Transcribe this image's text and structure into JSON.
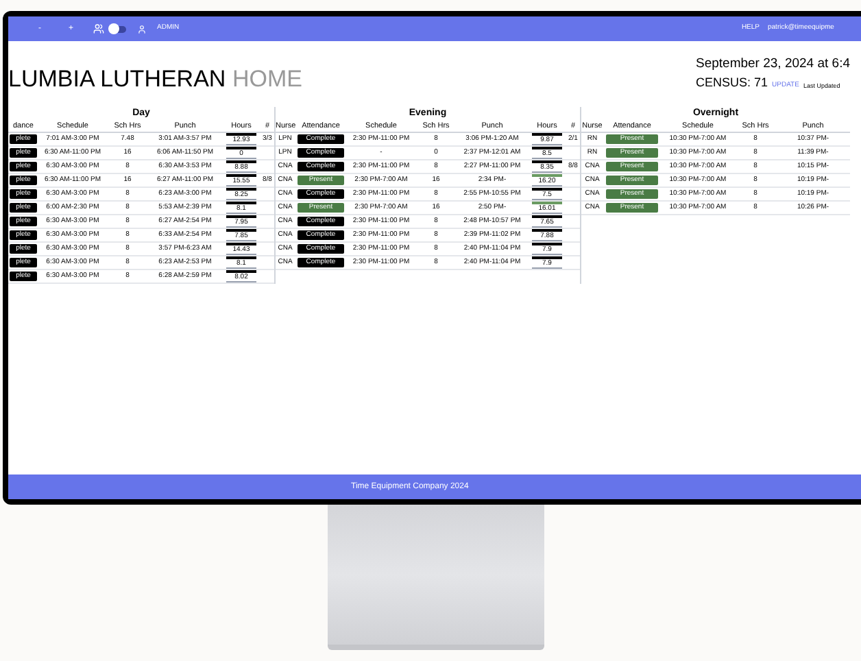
{
  "nav": {
    "minus": "-",
    "plus": "+",
    "toggle": {
      "on": false
    },
    "admin": "ADMIN",
    "help": "HELP",
    "user": "patrick@timeequipme"
  },
  "header": {
    "title": "LUMBIA LUTHERAN",
    "title_light": "HOME",
    "date": "September 23, 2024 at 6:4",
    "census": "CENSUS: 71",
    "update": "UPDATE",
    "last_updated": "Last Updated"
  },
  "day": {
    "title": "Day",
    "columns": [
      "dance",
      "Schedule",
      "Sch Hrs",
      "Punch",
      "Hours",
      "#"
    ],
    "rows": [
      {
        "attendance": {
          "label": "plete",
          "kind": "complete"
        },
        "schedule": "7:01 AM-3:00 PM",
        "sch_hrs": "7.48",
        "punch": "3:01 AM-3:57 PM",
        "hours": "12.93",
        "count": "3/3"
      },
      {
        "attendance": {
          "label": "plete",
          "kind": "complete"
        },
        "schedule": "6:30 AM-11:00 PM",
        "sch_hrs": "16",
        "punch": "6:06 AM-11:50 PM",
        "hours": "0"
      },
      {
        "attendance": {
          "label": "plete",
          "kind": "complete"
        },
        "schedule": "6:30 AM-3:00 PM",
        "sch_hrs": "8",
        "punch": "6:30 AM-3:53 PM",
        "hours": "8.88"
      },
      {
        "attendance": {
          "label": "plete",
          "kind": "complete"
        },
        "schedule": "6:30 AM-11:00 PM",
        "sch_hrs": "16",
        "punch": "6:27 AM-11:00 PM",
        "hours": "15.55",
        "count": "8/8"
      },
      {
        "attendance": {
          "label": "plete",
          "kind": "complete"
        },
        "schedule": "6:30 AM-3:00 PM",
        "sch_hrs": "8",
        "punch": "6:23 AM-3:00 PM",
        "hours": "8.25"
      },
      {
        "attendance": {
          "label": "plete",
          "kind": "complete"
        },
        "schedule": "6:00 AM-2:30 PM",
        "sch_hrs": "8",
        "punch": "5:53 AM-2:39 PM",
        "hours": "8.1"
      },
      {
        "attendance": {
          "label": "plete",
          "kind": "complete"
        },
        "schedule": "6:30 AM-3:00 PM",
        "sch_hrs": "8",
        "punch": "6:27 AM-2:54 PM",
        "hours": "7.95"
      },
      {
        "attendance": {
          "label": "plete",
          "kind": "complete"
        },
        "schedule": "6:30 AM-3:00 PM",
        "sch_hrs": "8",
        "punch": "6:33 AM-2:54 PM",
        "hours": "7.85"
      },
      {
        "attendance": {
          "label": "plete",
          "kind": "complete"
        },
        "schedule": "6:30 AM-3:00 PM",
        "sch_hrs": "8",
        "punch": "3:57 PM-6:23 AM",
        "hours": "14.43"
      },
      {
        "attendance": {
          "label": "plete",
          "kind": "complete"
        },
        "schedule": "6:30 AM-3:00 PM",
        "sch_hrs": "8",
        "punch": "6:23 AM-2:53 PM",
        "hours": "8.1"
      },
      {
        "attendance": {
          "label": "plete",
          "kind": "complete"
        },
        "schedule": "6:30 AM-3:00 PM",
        "sch_hrs": "8",
        "punch": "6:28 AM-2:59 PM",
        "hours": "8.02"
      }
    ]
  },
  "evening": {
    "title": "Evening",
    "columns": [
      "Nurse",
      "Attendance",
      "Schedule",
      "Sch Hrs",
      "Punch",
      "Hours",
      "#"
    ],
    "rows": [
      {
        "nurse": "LPN",
        "attendance": {
          "label": "Complete",
          "kind": "complete"
        },
        "schedule": "2:30 PM-11:00 PM",
        "sch_hrs": "8",
        "punch": "3:06 PM-1:20 AM",
        "hours": "9.87",
        "count": "2/1"
      },
      {
        "nurse": "LPN",
        "attendance": {
          "label": "Complete",
          "kind": "complete"
        },
        "schedule": "-",
        "sch_hrs": "0",
        "punch": "2:37 PM-12:01 AM",
        "hours": "8.5"
      },
      {
        "nurse": "CNA",
        "attendance": {
          "label": "Complete",
          "kind": "complete"
        },
        "schedule": "2:30 PM-11:00 PM",
        "sch_hrs": "8",
        "punch": "2:27 PM-11:00 PM",
        "hours": "8.35",
        "count": "8/8"
      },
      {
        "nurse": "CNA",
        "attendance": {
          "label": "Present",
          "kind": "present"
        },
        "schedule": "2:30 PM-7:00 AM",
        "sch_hrs": "16",
        "punch": "2:34 PM-",
        "hours": "16.20"
      },
      {
        "nurse": "CNA",
        "attendance": {
          "label": "Complete",
          "kind": "complete"
        },
        "schedule": "2:30 PM-11:00 PM",
        "sch_hrs": "8",
        "punch": "2:55 PM-10:55 PM",
        "hours": "7.5"
      },
      {
        "nurse": "CNA",
        "attendance": {
          "label": "Present",
          "kind": "present"
        },
        "schedule": "2:30 PM-7:00 AM",
        "sch_hrs": "16",
        "punch": "2:50 PM-",
        "hours": "16.01"
      },
      {
        "nurse": "CNA",
        "attendance": {
          "label": "Complete",
          "kind": "complete"
        },
        "schedule": "2:30 PM-11:00 PM",
        "sch_hrs": "8",
        "punch": "2:48 PM-10:57 PM",
        "hours": "7.65"
      },
      {
        "nurse": "CNA",
        "attendance": {
          "label": "Complete",
          "kind": "complete"
        },
        "schedule": "2:30 PM-11:00 PM",
        "sch_hrs": "8",
        "punch": "2:39 PM-11:02 PM",
        "hours": "7.88"
      },
      {
        "nurse": "CNA",
        "attendance": {
          "label": "Complete",
          "kind": "complete"
        },
        "schedule": "2:30 PM-11:00 PM",
        "sch_hrs": "8",
        "punch": "2:40 PM-11:04 PM",
        "hours": "7.9"
      },
      {
        "nurse": "CNA",
        "attendance": {
          "label": "Complete",
          "kind": "complete"
        },
        "schedule": "2:30 PM-11:00 PM",
        "sch_hrs": "8",
        "punch": "2:40 PM-11:04 PM",
        "hours": "7.9"
      }
    ]
  },
  "overnight": {
    "title": "Overnight",
    "columns": [
      "Nurse",
      "Attendance",
      "Schedule",
      "Sch Hrs",
      "Punch"
    ],
    "rows": [
      {
        "nurse": "RN",
        "attendance": {
          "label": "Present",
          "kind": "present"
        },
        "schedule": "10:30 PM-7:00 AM",
        "sch_hrs": "8",
        "punch": "10:37 PM-"
      },
      {
        "nurse": "RN",
        "attendance": {
          "label": "Present",
          "kind": "present"
        },
        "schedule": "10:30 PM-7:00 AM",
        "sch_hrs": "8",
        "punch": "11:39 PM-"
      },
      {
        "nurse": "CNA",
        "attendance": {
          "label": "Present",
          "kind": "present"
        },
        "schedule": "10:30 PM-7:00 AM",
        "sch_hrs": "8",
        "punch": "10:15 PM-"
      },
      {
        "nurse": "CNA",
        "attendance": {
          "label": "Present",
          "kind": "present"
        },
        "schedule": "10:30 PM-7:00 AM",
        "sch_hrs": "8",
        "punch": "10:19 PM-"
      },
      {
        "nurse": "CNA",
        "attendance": {
          "label": "Present",
          "kind": "present"
        },
        "schedule": "10:30 PM-7:00 AM",
        "sch_hrs": "8",
        "punch": "10:19 PM-"
      },
      {
        "nurse": "CNA",
        "attendance": {
          "label": "Present",
          "kind": "present"
        },
        "schedule": "10:30 PM-7:00 AM",
        "sch_hrs": "8",
        "punch": "10:26 PM-"
      }
    ]
  },
  "footer": "Time Equipment Company 2024"
}
